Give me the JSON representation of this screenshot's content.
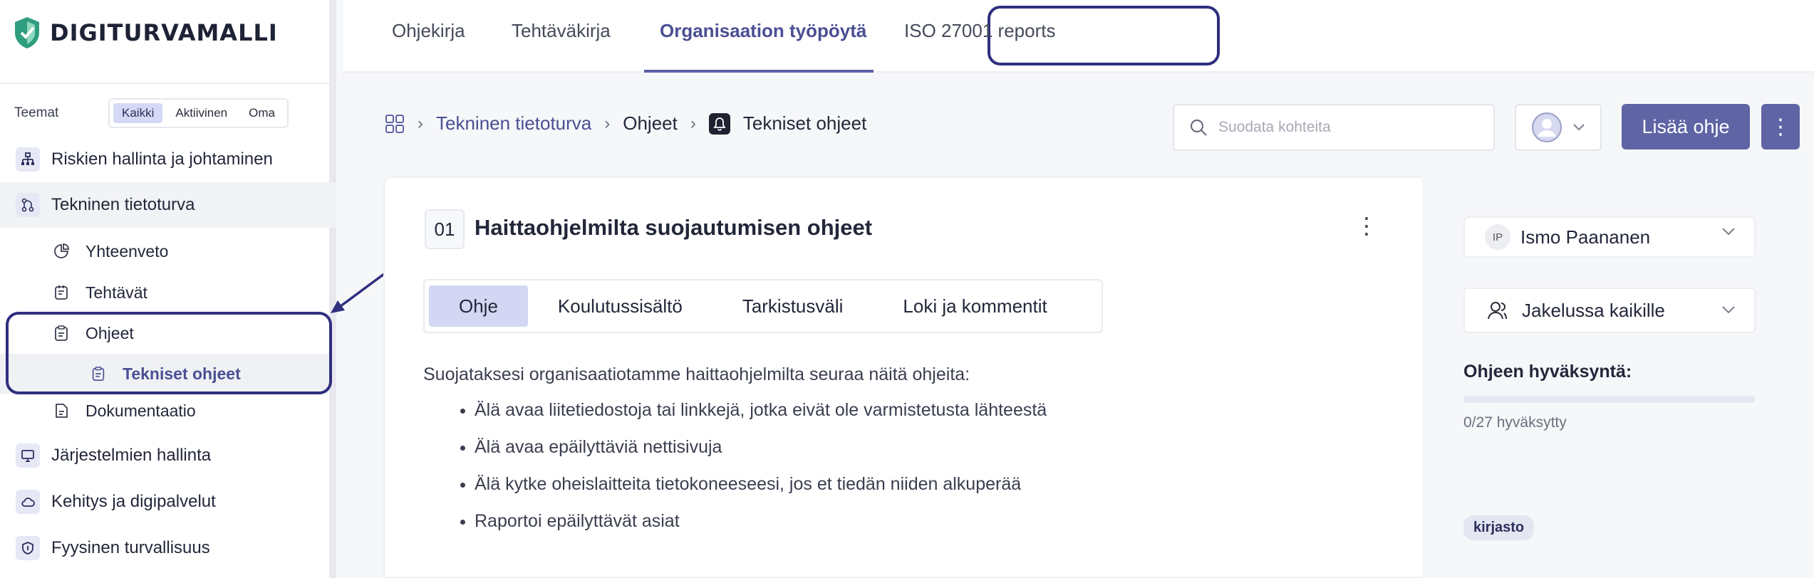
{
  "brand": {
    "name": "DIGITURVAMALLI"
  },
  "top_tabs": [
    {
      "label": "Ohjekirja"
    },
    {
      "label": "Tehtäväkirja"
    },
    {
      "label": "Organisaation työpöytä",
      "active": true
    },
    {
      "label": "ISO 27001 reports"
    }
  ],
  "sidebar": {
    "themes_label": "Teemat",
    "filters": [
      "Kaikki",
      "Aktiivinen",
      "Oma"
    ],
    "active_filter": "Kaikki",
    "items": [
      {
        "label": "Riskien hallinta ja johtaminen",
        "icon": "org-chart-icon"
      },
      {
        "label": "Tekninen tietoturva",
        "icon": "branch-icon",
        "selected": true
      },
      {
        "label": "Järjestelmien hallinta",
        "icon": "monitor-icon"
      },
      {
        "label": "Kehitys ja digipalvelut",
        "icon": "cloud-icon"
      },
      {
        "label": "Fyysinen turvallisuus",
        "icon": "shield-icon"
      }
    ],
    "subitems": [
      {
        "label": "Yhteenveto",
        "icon": "pie-chart-icon"
      },
      {
        "label": "Tehtävät",
        "icon": "task-list-icon"
      },
      {
        "label": "Ohjeet",
        "icon": "clipboard-icon"
      },
      {
        "label": "Tekniset ohjeet",
        "icon": "clipboard-icon",
        "active": true
      },
      {
        "label": "Dokumentaatio",
        "icon": "document-icon"
      }
    ]
  },
  "breadcrumb": {
    "items": [
      "Tekninen tietoturva",
      "Ohjeet",
      "Tekniset ohjeet"
    ]
  },
  "search": {
    "placeholder": "Suodata kohteita"
  },
  "actions": {
    "add_label": "Lisää ohje",
    "more_label": "⋮"
  },
  "card": {
    "number": "01",
    "title": "Haittaohjelmilta suojautumisen ohjeet",
    "tabs": [
      "Ohje",
      "Koulutussisältö",
      "Tarkistusväli",
      "Loki ja kommentit"
    ],
    "active_tab": "Ohje",
    "intro": "Suojataksesi organisaatiotamme haittaohjelmilta seuraa näitä ohjeita:",
    "bullets": [
      "Älä avaa liitetiedostoja tai linkkejä, jotka eivät ole varmistetusta lähteestä",
      "Älä avaa epäilyttäviä nettisivuja",
      "Älä kytke oheislaitteita tietokoneeseesi, jos et tiedän niiden alkuperää",
      "Raportoi epäilyttävät asiat"
    ]
  },
  "right_panel": {
    "owner_initials": "IP",
    "owner_name": "Ismo Paananen",
    "distribution": "Jakelussa kaikille",
    "approval_label": "Ohjeen hyväksyntä:",
    "approval_count": "0/27 hyväksytty",
    "approval_fraction": 0,
    "tag": "kirjasto"
  },
  "colors": {
    "accent": "#5f64a5",
    "highlight_border": "#2f2f7f",
    "active_filter_bg": "#d6d9f5"
  }
}
